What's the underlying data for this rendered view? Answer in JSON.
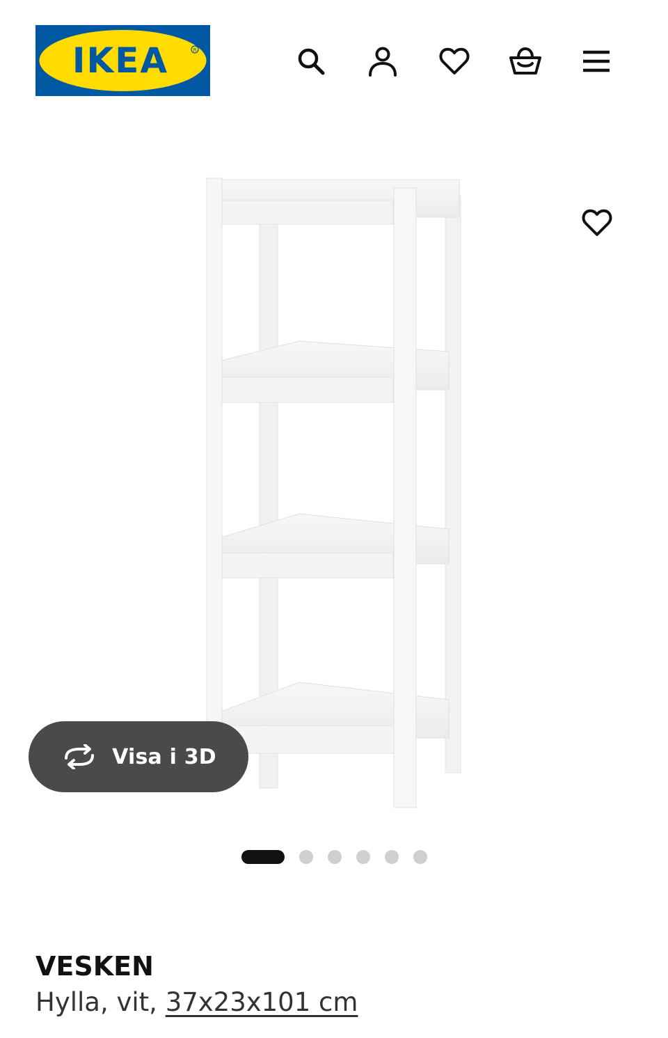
{
  "header": {
    "logo_text": "IKEA",
    "icons": [
      "search-icon",
      "user-icon",
      "heart-icon",
      "basket-icon",
      "menu-icon"
    ]
  },
  "gallery": {
    "view3d_label": "Visa i 3D",
    "slide_count": 6,
    "active_slide": 1
  },
  "product": {
    "name": "VESKEN",
    "description": "Hylla, vit, ",
    "dimensions": "37x23x101 cm"
  },
  "colors": {
    "brand_blue": "#0058a3",
    "brand_yellow": "#ffdb00",
    "pill_background": "#4a4a4a",
    "dot_active": "#111111",
    "dot_inactive": "#cfcfcf"
  }
}
